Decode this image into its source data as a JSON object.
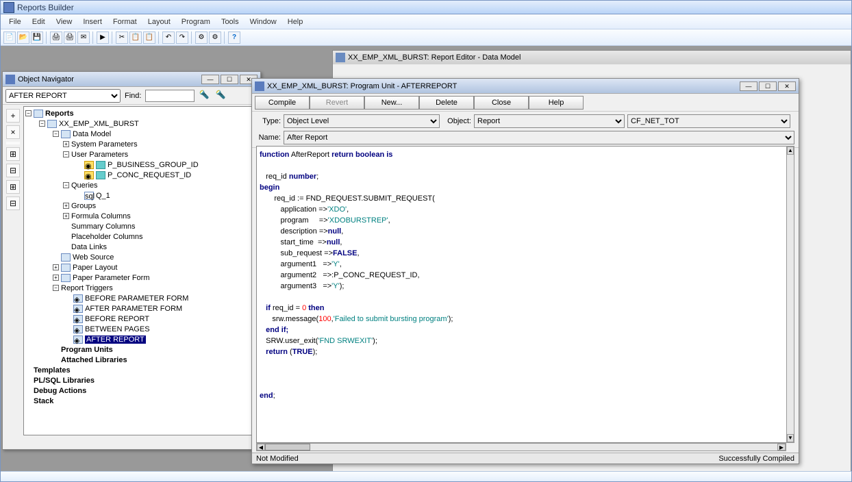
{
  "app": {
    "title": "Reports Builder"
  },
  "menu": [
    "File",
    "Edit",
    "View",
    "Insert",
    "Format",
    "Layout",
    "Program",
    "Tools",
    "Window",
    "Help"
  ],
  "dm_title": "XX_EMP_XML_BURST: Report Editor - Data Model",
  "nav": {
    "title": "Object Navigator",
    "dropdown": "AFTER REPORT",
    "find_label": "Find:",
    "find_value": ""
  },
  "tree": {
    "root": "Reports",
    "report_name": "XX_EMP_XML_BURST",
    "data_model": "Data Model",
    "sys_params": "System Parameters",
    "user_params": "User Parameters",
    "p1": "P_BUSINESS_GROUP_ID",
    "p2": "P_CONC_REQUEST_ID",
    "queries": "Queries",
    "q1": "Q_1",
    "groups": "Groups",
    "formula": "Formula Columns",
    "summary": "Summary Columns",
    "placeholder": "Placeholder Columns",
    "datalinks": "Data Links",
    "websource": "Web Source",
    "paper_layout": "Paper Layout",
    "paper_param": "Paper Parameter Form",
    "triggers": "Report Triggers",
    "t1": "BEFORE PARAMETER FORM",
    "t2": "AFTER PARAMETER FORM",
    "t3": "BEFORE REPORT",
    "t4": "BETWEEN PAGES",
    "t5": "AFTER REPORT",
    "prog_units": "Program Units",
    "libs": "Attached Libraries",
    "templates": "Templates",
    "plsql": "PL/SQL Libraries",
    "debug": "Debug Actions",
    "stack": "Stack"
  },
  "pu": {
    "title": "XX_EMP_XML_BURST: Program Unit - AFTERREPORT",
    "buttons": {
      "compile": "Compile",
      "revert": "Revert",
      "new": "New...",
      "delete": "Delete",
      "close": "Close",
      "help": "Help"
    },
    "type_label": "Type:",
    "type_value": "Object Level",
    "object_label": "Object:",
    "object_value": "Report",
    "cf_value": "CF_NET_TOT",
    "name_label": "Name:",
    "name_value": "After Report",
    "status_left": "Not Modified",
    "status_right": "Successfully Compiled"
  },
  "code": {
    "l1a": "function",
    "l1b": " AfterReport ",
    "l1c": "return boolean is",
    "l3": "   req_id ",
    "l3b": "number",
    "l3c": ";",
    "l4": "begin",
    "l5a": "       req_id := FND_REQUEST.SUBMIT_REQUEST(",
    "l6a": "          application =>",
    "l6s": "'XDO'",
    "l6e": ",",
    "l7a": "          program     =>",
    "l7s": "'XDOBURSTREP'",
    "l7e": ",",
    "l8a": "          description =>",
    "l8k": "null",
    "l8e": ",",
    "l9a": "          start_time  =>",
    "l9k": "null",
    "l9e": ",",
    "l10a": "          sub_request =>",
    "l10k": "FALSE",
    "l10e": ",",
    "l11a": "          argument1   =>",
    "l11s": "'Y'",
    "l11e": ",",
    "l12a": "          argument2   =>:P_CONC_REQUEST_ID,",
    "l13a": "          argument3   =>",
    "l13s": "'Y'",
    "l13e": ");",
    "l15a": "   if",
    "l15b": " req_id = ",
    "l15n": "0",
    "l15c": " ",
    "l15d": "then",
    "l16a": "      srw.message(",
    "l16n": "100",
    "l16b": ",",
    "l16s": "'Failed to submit bursting program'",
    "l16e": ");",
    "l17": "   end if;",
    "l18a": "   SRW.user_exit(",
    "l18s": "'FND SRWEXIT'",
    "l18e": ");",
    "l19a": "   return",
    "l19b": " (",
    "l19k": "TRUE",
    "l19c": ");",
    "l23": "end",
    "l23b": ";"
  }
}
